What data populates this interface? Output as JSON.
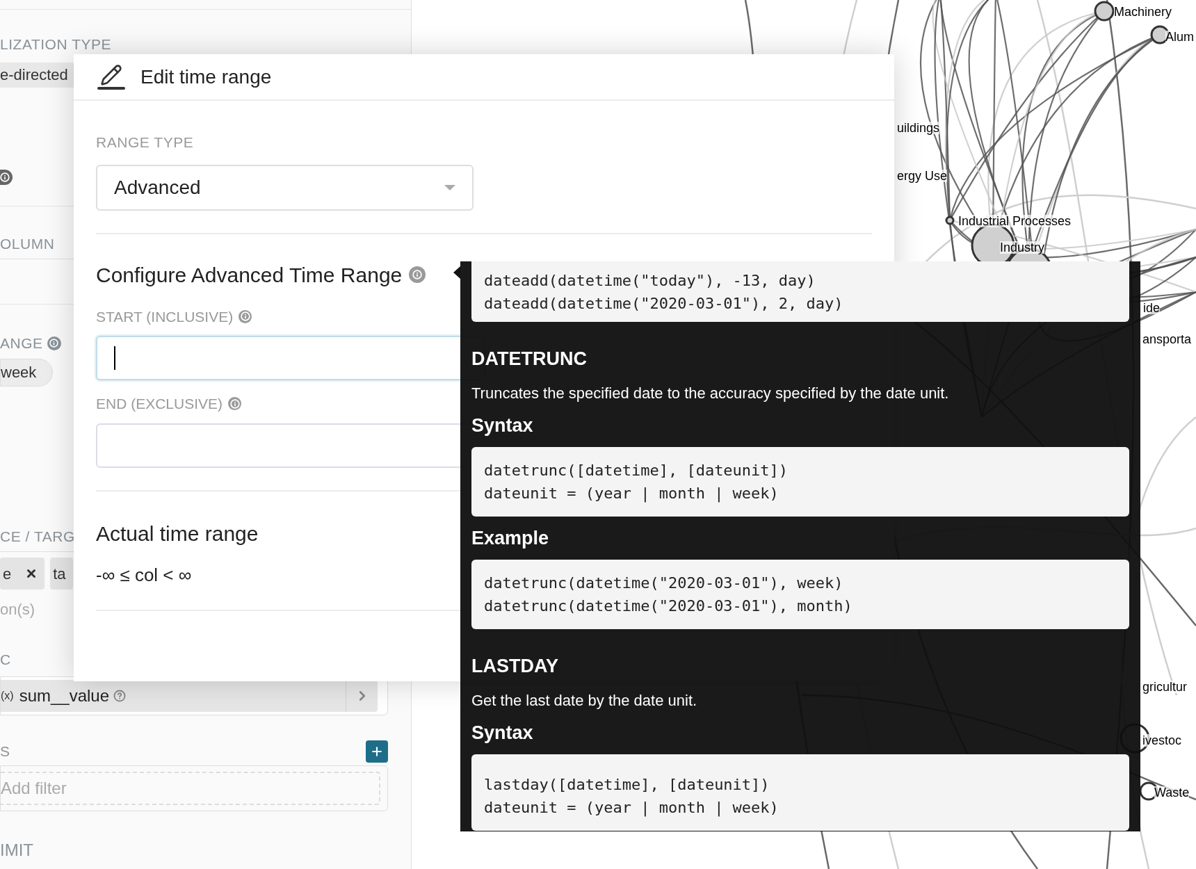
{
  "sidebar": {
    "visualization_type": {
      "label": "LIZATION TYPE",
      "value": "e-directed"
    },
    "column": {
      "label": "OLUMN"
    },
    "time_range": {
      "label": "ANGE",
      "value": "week"
    },
    "source_target": {
      "label": "CE / TARG",
      "chips": [
        {
          "text": "e",
          "removable": true
        },
        {
          "text": "ta",
          "removable": false
        }
      ],
      "placeholder": "on(s)"
    },
    "metric": {
      "label": "C",
      "prefix": "(x)",
      "value": "sum__value"
    },
    "filters": {
      "label": "S",
      "placeholder": "Add filter"
    },
    "limit": {
      "label": "IMIT"
    }
  },
  "popover": {
    "title": "Edit time range",
    "range_type": {
      "label": "RANGE TYPE",
      "value": "Advanced"
    },
    "section_title": "Configure Advanced Time Range",
    "start": {
      "label": "START (INCLUSIVE)",
      "focused": true
    },
    "end": {
      "label": "END (EXCLUSIVE)",
      "focused": false
    },
    "actual": {
      "title": "Actual time range",
      "value": "-∞ ≤ col < ∞"
    }
  },
  "tooltip": {
    "blocks": [
      {
        "kind": "code",
        "lines": [
          "dateadd(datetime(\"today\"), -13, day)",
          "dateadd(datetime(\"2020-03-01\"), 2, day)"
        ]
      },
      {
        "kind": "heading",
        "text": "DATETRUNC"
      },
      {
        "kind": "text",
        "text": "Truncates the specified date to the accuracy specified by the date unit."
      },
      {
        "kind": "subheading",
        "text": "Syntax"
      },
      {
        "kind": "code",
        "lines": [
          "datetrunc([datetime], [dateunit])",
          "dateunit = (year | month | week)"
        ]
      },
      {
        "kind": "subheading",
        "text": "Example"
      },
      {
        "kind": "code",
        "lines": [
          "datetrunc(datetime(\"2020-03-01\"), week)",
          "datetrunc(datetime(\"2020-03-01\"), month)"
        ]
      },
      {
        "kind": "heading",
        "text": "LASTDAY"
      },
      {
        "kind": "text",
        "text": "Get the last date by the date unit."
      },
      {
        "kind": "subheading",
        "text": "Syntax"
      },
      {
        "kind": "code",
        "lines": [
          "lastday([datetime], [dateunit])",
          "dateunit = (year | month | week)"
        ]
      }
    ]
  },
  "graph": {
    "labels": [
      "Machinery",
      "Alum",
      "uildings",
      "ergy Use",
      "Industrial Processes",
      "Industry",
      "ide",
      "ansporta",
      "gricultur",
      "ivestoc",
      "Waste"
    ]
  }
}
